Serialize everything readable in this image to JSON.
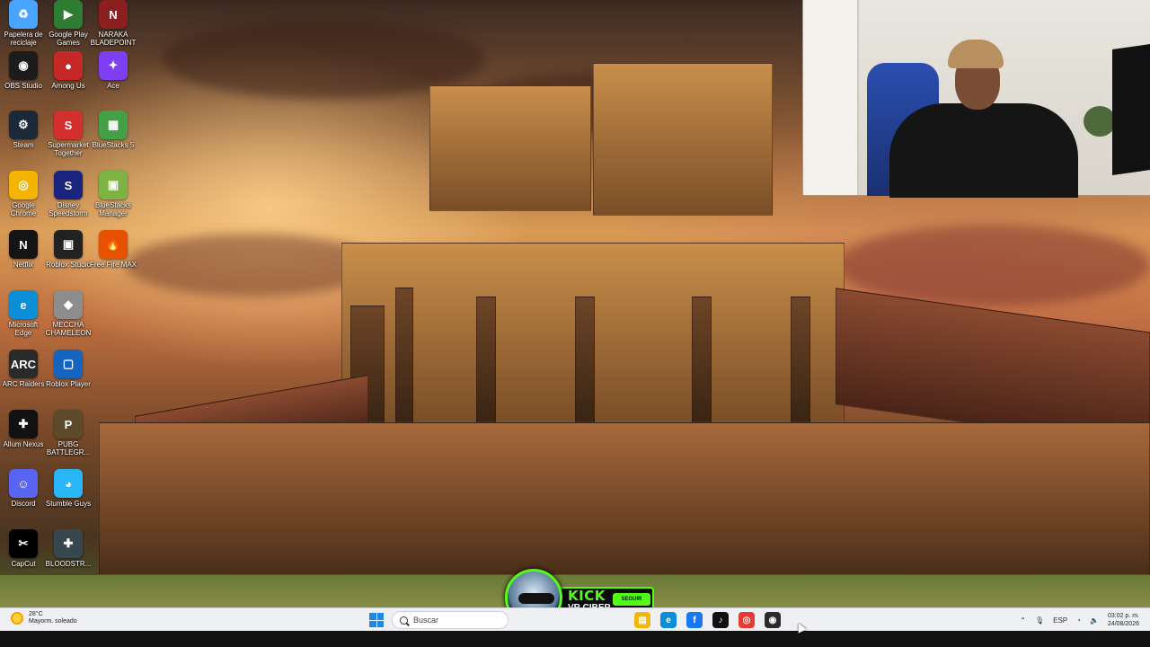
{
  "desktop_icons": [
    {
      "label": "Papelera de reciclaje",
      "icon": "recycle-bin-icon",
      "color": "#4aa3ff"
    },
    {
      "label": "Google Play Games",
      "icon": "google-play-games-icon",
      "color": "#2e7d32"
    },
    {
      "label": "NARAKA BLADEPOINT",
      "icon": "naraka-icon",
      "color": "#8b1e1e"
    },
    {
      "label": "OBS Studio",
      "icon": "obs-icon",
      "color": "#1c1c1c"
    },
    {
      "label": "Among Us",
      "icon": "among-us-icon",
      "color": "#c62828"
    },
    {
      "label": "Ace",
      "icon": "ace-icon",
      "color": "#7e3ff2"
    },
    {
      "label": "Steam",
      "icon": "steam-icon",
      "color": "#1b2838"
    },
    {
      "label": "Supermarket Together",
      "icon": "supermarket-icon",
      "color": "#d32f2f"
    },
    {
      "label": "BlueStacks 5",
      "icon": "bluestacks-icon",
      "color": "#43a047"
    },
    {
      "label": "Google Chrome",
      "icon": "chrome-icon",
      "color": "#f4b400"
    },
    {
      "label": "Disney Speedstorm",
      "icon": "disney-speedstorm-icon",
      "color": "#1a237e"
    },
    {
      "label": "BlueStacks Manager",
      "icon": "bluestacks-manager-icon",
      "color": "#7cb342"
    },
    {
      "label": "Netflix",
      "icon": "netflix-icon",
      "color": "#141414"
    },
    {
      "label": "Roblox Studio",
      "icon": "roblox-studio-icon",
      "color": "#222222"
    },
    {
      "label": "Free Fire MAX",
      "icon": "free-fire-icon",
      "color": "#e65100"
    },
    {
      "label": "Microsoft Edge",
      "icon": "edge-icon",
      "color": "#0c8fd6"
    },
    {
      "label": "MECCHA CHAMELEON",
      "icon": "meccha-chameleon-icon",
      "color": "#8d8d8d"
    },
    {
      "label": "ARC Raiders",
      "icon": "arc-raiders-icon",
      "color": "#2a2a2a"
    },
    {
      "label": "Roblox Player",
      "icon": "roblox-player-icon",
      "color": "#1565c0"
    },
    {
      "label": "Allum Nexus",
      "icon": "nexus-icon",
      "color": "#111111"
    },
    {
      "label": "PUBG BATTLEGR...",
      "icon": "pubg-icon",
      "color": "#5d4a2a"
    },
    {
      "label": "Discord",
      "icon": "discord-icon",
      "color": "#5865f2"
    },
    {
      "label": "Stumble Guys",
      "icon": "stumble-guys-icon",
      "color": "#29b6f6"
    },
    {
      "label": "CapCut",
      "icon": "capcut-icon",
      "color": "#000000"
    },
    {
      "label": "BLOODSTR...",
      "icon": "bloodstrike-icon",
      "color": "#37474f"
    }
  ],
  "icon_glyphs": [
    "♻",
    "▶",
    "N",
    "◉",
    "●",
    "✦",
    "⚙",
    "S",
    "▦",
    "◎",
    "S",
    "▣",
    "N",
    "▣",
    "🔥",
    "e",
    "◆",
    "ARC",
    "▢",
    "✚",
    "P",
    "☺",
    "◕",
    "✂",
    "✚"
  ],
  "kick_overlay": {
    "logo": "KICK",
    "name": "VR CIBER",
    "follow_label": "SEGUIR"
  },
  "taskbar": {
    "weather_temp": "28°C",
    "weather_desc": "Mayorm. soleado",
    "search_placeholder": "Buscar",
    "language": "ESP",
    "time": "03:02 p. m.",
    "date": "24/08/2026",
    "apps": [
      {
        "name": "file-explorer-icon",
        "glyph": "▤",
        "color": "#f2b705"
      },
      {
        "name": "edge-taskbar-icon",
        "glyph": "e",
        "color": "#0c8fd6"
      },
      {
        "name": "facebook-icon",
        "glyph": "f",
        "color": "#1877f2"
      },
      {
        "name": "tiktok-icon",
        "glyph": "♪",
        "color": "#111111"
      },
      {
        "name": "chrome-taskbar-icon",
        "glyph": "◎",
        "color": "#e53935"
      },
      {
        "name": "obs-taskbar-icon",
        "glyph": "◉",
        "color": "#2b2b2b"
      }
    ]
  },
  "colors": {
    "kick_green": "#53fc18",
    "taskbar_bg": "#eef0f4"
  }
}
